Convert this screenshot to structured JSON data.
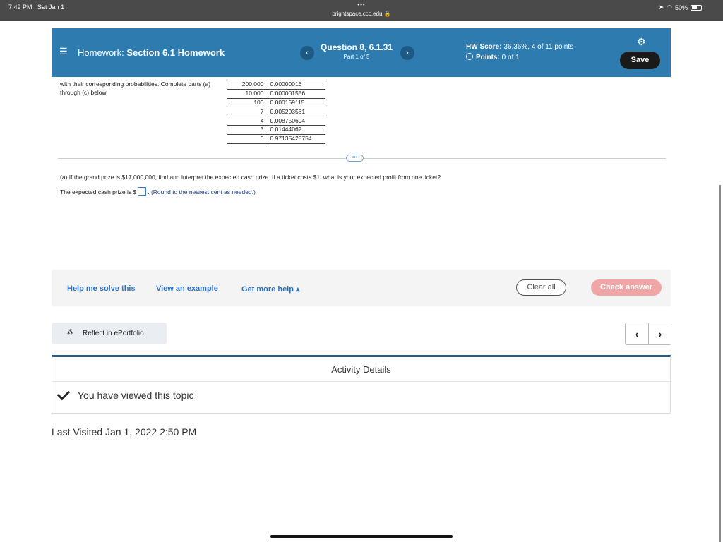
{
  "status": {
    "time": "7:49 PM",
    "date": "Sat Jan 1",
    "battery": "50%",
    "url": "brightspace.ccc.edu",
    "dots": "•••"
  },
  "header": {
    "title_prefix": "Homework:",
    "title": "Section 6.1 Homework",
    "question": "Question 8, 6.1.31",
    "part": "Part 1 of 5",
    "prev": "‹",
    "next": "›",
    "hw_score_label": "HW Score:",
    "hw_score_value": "36.36%, 4 of 11 points",
    "points_label": "Points:",
    "points_value": "0 of 1",
    "save_label": "Save"
  },
  "problem": {
    "intro": "with their corresponding probabilities. Complete parts (a) through (c) below.",
    "table": [
      {
        "value": "200,000",
        "prob": "0.00000016"
      },
      {
        "value": "10,000",
        "prob": "0.000001556"
      },
      {
        "value": "100",
        "prob": "0.000159115"
      },
      {
        "value": "7",
        "prob": "0.005293561"
      },
      {
        "value": "4",
        "prob": "0.008750694"
      },
      {
        "value": "3",
        "prob": "0.01444062"
      },
      {
        "value": "0",
        "prob": "0.97135428754"
      }
    ],
    "more": "•••",
    "part_a": "(a) If the grand prize is $17,000,000, find and interpret the expected cash prize. If a ticket costs $1, what is your expected profit from one ticket?",
    "answer_prefix": "The expected cash prize is $",
    "answer_suffix": ".",
    "answer_hint": "(Round to the nearest cent as needed.)"
  },
  "help": {
    "help_me": "Help me solve this",
    "example": "View an example",
    "more_help": "Get more help ▴",
    "clear": "Clear all",
    "check": "Check answer"
  },
  "portfolio": {
    "reflect": "Reflect in ePortfolio",
    "prev": "‹",
    "next": "›"
  },
  "activity": {
    "title": "Activity Details",
    "viewed": "You have viewed this topic",
    "last_visited": "Last Visited Jan 1, 2022 2:50 PM"
  }
}
